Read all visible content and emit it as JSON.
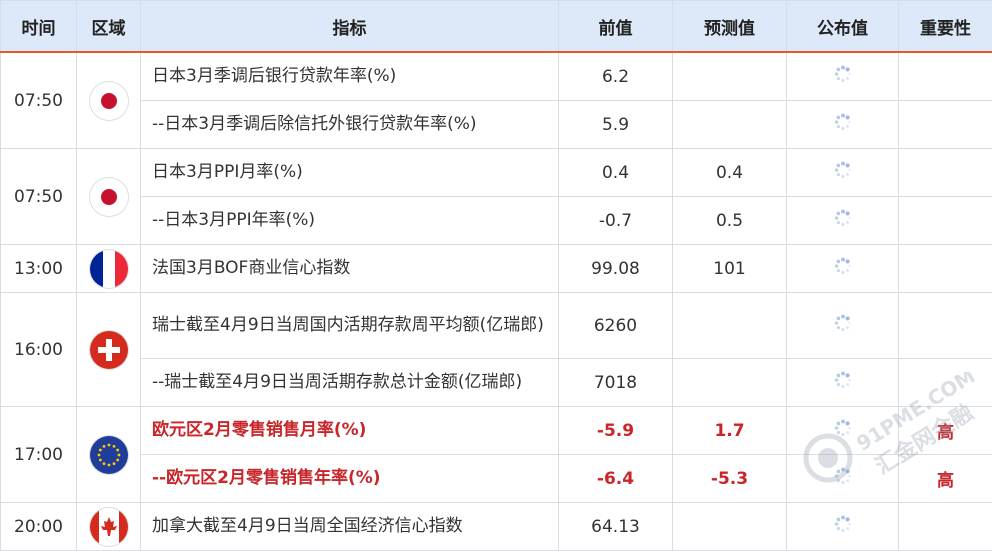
{
  "header": {
    "time": "时间",
    "region": "区域",
    "indicator": "指标",
    "previous": "前值",
    "forecast": "预测值",
    "actual": "公布值",
    "importance": "重要性"
  },
  "rows": [
    {
      "time": "07:50",
      "country": "japan-flag-icon",
      "indicator": "日本3月季调后银行贷款年率(%)",
      "previous": "6.2",
      "forecast": "",
      "importance": ""
    },
    {
      "indicator": "--日本3月季调后除信托外银行贷款年率(%)",
      "previous": "5.9",
      "forecast": "",
      "importance": ""
    },
    {
      "time": "07:50",
      "country": "japan-flag-icon",
      "indicator": "日本3月PPI月率(%)",
      "previous": "0.4",
      "forecast": "0.4",
      "importance": ""
    },
    {
      "indicator": "--日本3月PPI年率(%)",
      "previous": "-0.7",
      "forecast": "0.5",
      "importance": ""
    },
    {
      "time": "13:00",
      "country": "france-flag-icon",
      "indicator": "法国3月BOF商业信心指数",
      "previous": "99.08",
      "forecast": "101",
      "importance": ""
    },
    {
      "time": "16:00",
      "country": "switzerland-flag-icon",
      "indicator": "瑞士截至4月9日当周国内活期存款周平均额(亿瑞郎)",
      "previous": "6260",
      "forecast": "",
      "importance": ""
    },
    {
      "indicator": "--瑞士截至4月9日当周活期存款总计金额(亿瑞郎)",
      "previous": "7018",
      "forecast": "",
      "importance": ""
    },
    {
      "time": "17:00",
      "country": "eu-flag-icon",
      "indicator": "欧元区2月零售销售月率(%)",
      "previous": "-5.9",
      "forecast": "1.7",
      "importance": "高"
    },
    {
      "indicator": "--欧元区2月零售销售年率(%)",
      "previous": "-6.4",
      "forecast": "-5.3",
      "importance": "高"
    },
    {
      "time": "20:00",
      "country": "canada-flag-icon",
      "indicator": "加拿大截至4月9日当周全国经济信心指数",
      "previous": "64.13",
      "forecast": "",
      "importance": ""
    }
  ],
  "watermark": {
    "brand": "91PME.COM",
    "text": "汇金网金融"
  },
  "colors": {
    "header_bg": "#dde8f8",
    "header_border": "#e05a2b",
    "highlight_text": "#c8262a",
    "grid": "#d9dde3"
  }
}
